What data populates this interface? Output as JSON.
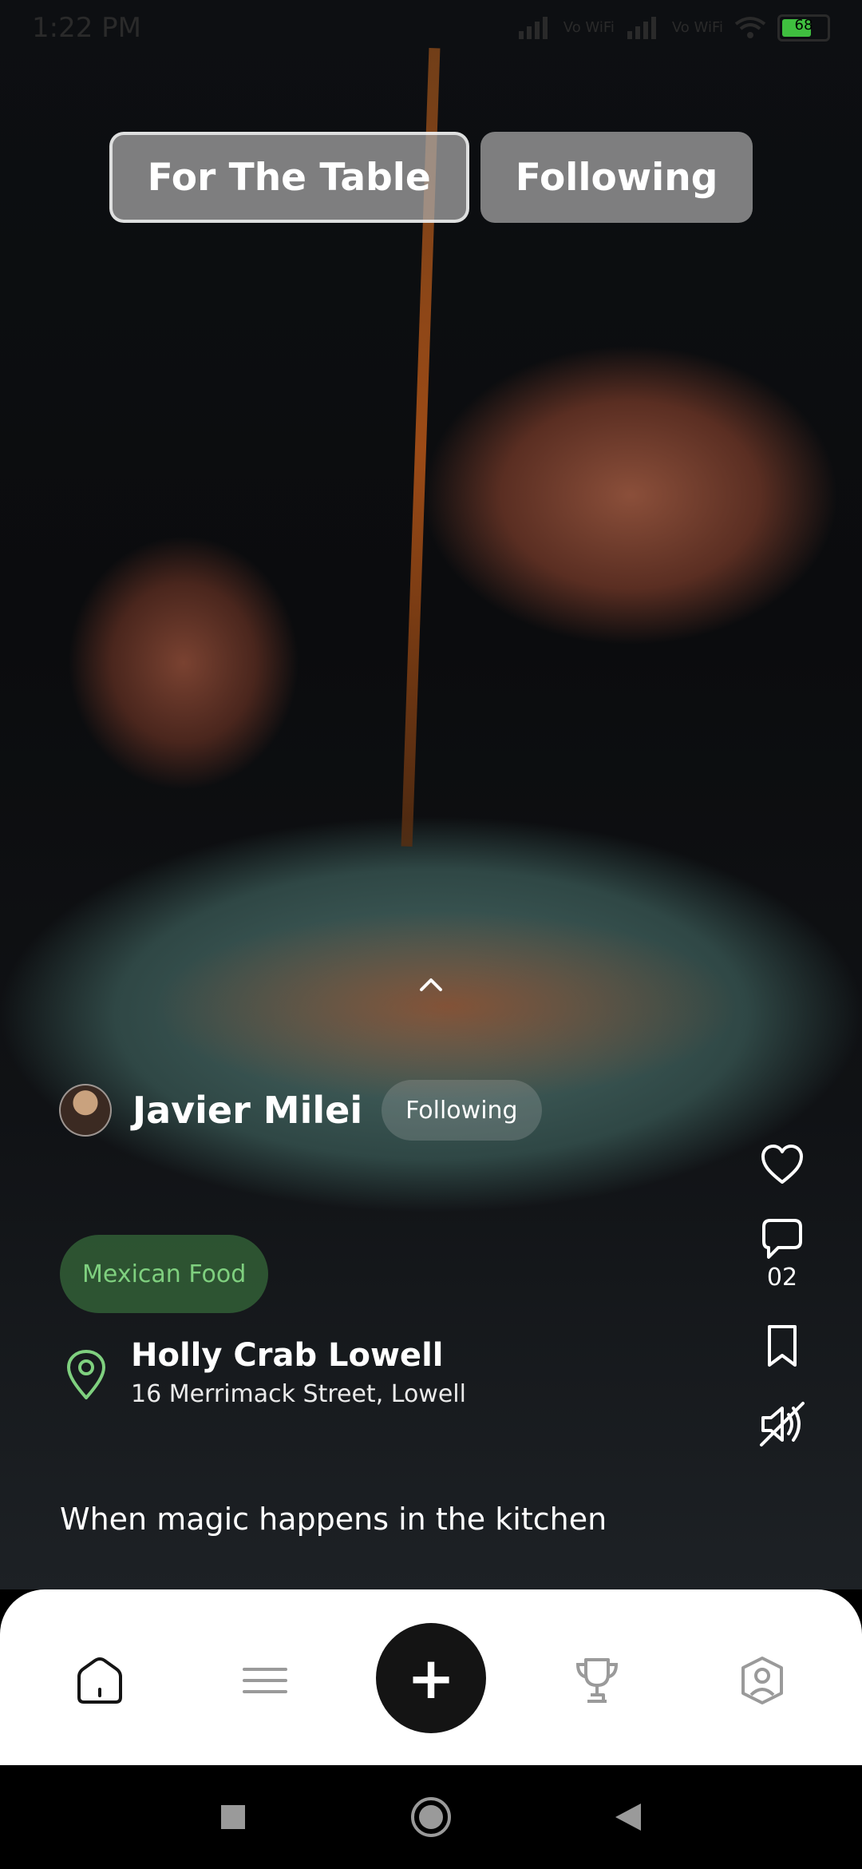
{
  "status_bar": {
    "time": "1:22 PM",
    "network_1": "Vo\nWiFi",
    "network_2": "Vo\nWiFi",
    "battery": "68"
  },
  "top_tabs": [
    {
      "label": "For The Table",
      "active": true
    },
    {
      "label": "Following",
      "active": false
    }
  ],
  "post": {
    "author_name": "Javier Milei",
    "follow_status": "Following",
    "cuisine_tag": "Mexican Food",
    "restaurant_name": "Holly Crab Lowell",
    "restaurant_address": "16 Merrimack Street, Lowell",
    "caption": "When magic happens in the kitchen",
    "comment_count": "02"
  },
  "icons": {
    "like": "heart-icon",
    "comment": "comment-icon",
    "save": "bookmark-icon",
    "mute": "mute-icon",
    "location": "location-pin-icon",
    "expand": "chevron-up-icon"
  },
  "bottom_nav": {
    "items": [
      "home-icon",
      "feed-icon",
      "add-icon",
      "trophy-icon",
      "profile-icon"
    ],
    "add_label": "+"
  },
  "colors": {
    "tag_text": "#7fd07f",
    "tag_bg": "#376e3c",
    "fab_bg": "#141414",
    "nav_inactive": "#9a9a9a"
  }
}
